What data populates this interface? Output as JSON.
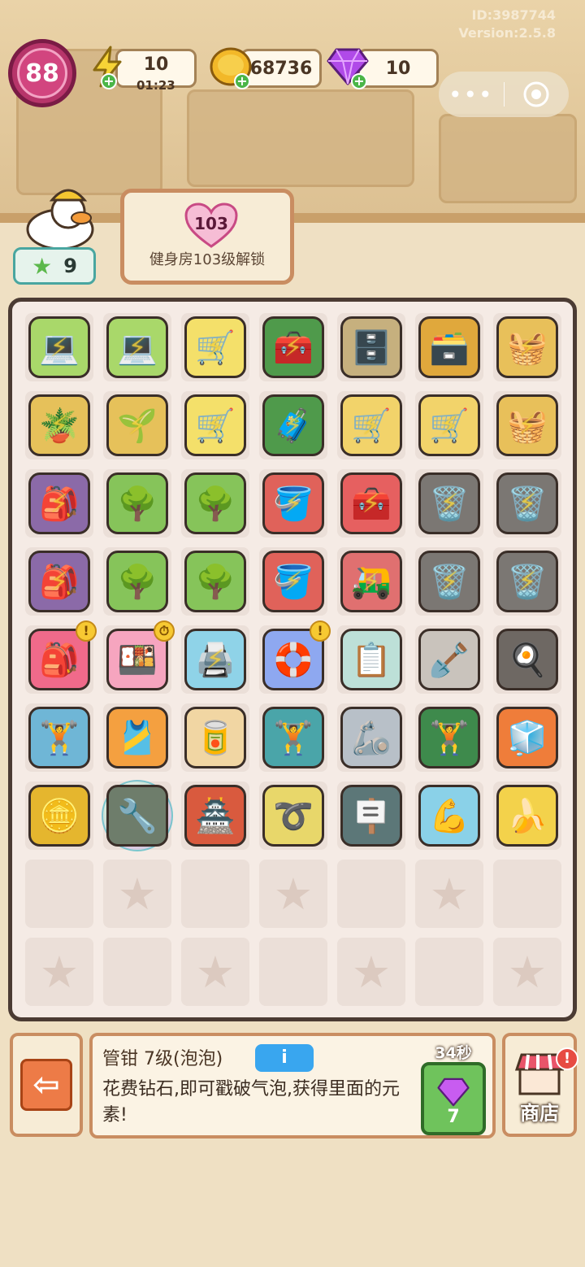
{
  "meta": {
    "id_text": "ID:3987744",
    "version_text": "Version:2.5.8"
  },
  "hud": {
    "level": "88",
    "energy": {
      "value": "10",
      "timer": "01:23",
      "icon": "lightning-icon"
    },
    "coins": {
      "value": "68736",
      "icon": "coin-icon"
    },
    "gems": {
      "value": "10",
      "icon": "gem-icon"
    }
  },
  "capsule": {
    "more_icon": "more-dots-icon",
    "close_icon": "target-icon"
  },
  "player": {
    "stars": "9"
  },
  "unlock": {
    "level": "103",
    "text": "健身房103级解锁"
  },
  "board": {
    "rows": [
      [
        {
          "icon": "💻",
          "color": "#a9d86a",
          "bolt": true
        },
        {
          "icon": "💻",
          "color": "#a9d86a",
          "bolt": true
        },
        {
          "icon": "🛒",
          "color": "#f4e06a",
          "bolt": true
        },
        {
          "icon": "🧰",
          "color": "#4f9a4b",
          "bolt": true
        },
        {
          "icon": "🗄️",
          "color": "#c6b07e",
          "bolt": false
        },
        {
          "icon": "🗃️",
          "color": "#e0a83c",
          "bolt": false
        },
        {
          "icon": "🧺",
          "color": "#e8c05a",
          "bolt": true
        }
      ],
      [
        {
          "icon": "🪴",
          "color": "#e6c15a",
          "bolt": true
        },
        {
          "icon": "🌱",
          "color": "#e6c15a",
          "bolt": true
        },
        {
          "icon": "🛒",
          "color": "#f4e06a",
          "bolt": true
        },
        {
          "icon": "🧳",
          "color": "#4f9a4b",
          "bolt": true
        },
        {
          "icon": "🛒",
          "color": "#f2d36a",
          "bolt": true
        },
        {
          "icon": "🛒",
          "color": "#f2d36a",
          "bolt": true
        },
        {
          "icon": "🧺",
          "color": "#e8c05a",
          "bolt": true
        }
      ],
      [
        {
          "icon": "🎒",
          "color": "#8b6aa8",
          "bolt": true
        },
        {
          "icon": "🌳",
          "color": "#86c45a",
          "bolt": false
        },
        {
          "icon": "🌳",
          "color": "#86c45a",
          "bolt": false
        },
        {
          "icon": "🪣",
          "color": "#e0625a",
          "bolt": true
        },
        {
          "icon": "🧰",
          "color": "#e66060",
          "bolt": true
        },
        {
          "icon": "🗑️",
          "color": "#7b7773",
          "bolt": true
        },
        {
          "icon": "🗑️",
          "color": "#7b7773",
          "bolt": true
        }
      ],
      [
        {
          "icon": "🎒",
          "color": "#8b6aa8",
          "bolt": true
        },
        {
          "icon": "🌳",
          "color": "#86c45a",
          "bolt": false
        },
        {
          "icon": "🌳",
          "color": "#86c45a",
          "bolt": false
        },
        {
          "icon": "🪣",
          "color": "#e0625a",
          "bolt": true
        },
        {
          "icon": "🛺",
          "color": "#e07070",
          "bolt": true
        },
        {
          "icon": "🗑️",
          "color": "#7b7773",
          "bolt": true
        },
        {
          "icon": "🗑️",
          "color": "#7b7773",
          "bolt": true
        }
      ],
      [
        {
          "icon": "🎒",
          "color": "#f06a8a",
          "bolt": false,
          "badge": "!"
        },
        {
          "icon": "🍱",
          "color": "#f6a5bf",
          "bolt": false,
          "badge": "⏱"
        },
        {
          "icon": "🖨️",
          "color": "#8fd3e8",
          "bolt": true
        },
        {
          "icon": "🛟",
          "color": "#8ea8f0",
          "bolt": false,
          "badge": "!"
        },
        {
          "icon": "📋",
          "color": "#bde0d8",
          "bolt": false
        },
        {
          "icon": "🪏",
          "color": "#c9c3bc",
          "bolt": false
        },
        {
          "icon": "🍳",
          "color": "#6e6863",
          "bolt": false
        }
      ],
      [
        {
          "icon": "🏋️",
          "color": "#6fb6d6",
          "bolt": false
        },
        {
          "icon": "🎽",
          "color": "#f4a040",
          "bolt": false
        },
        {
          "icon": "🥫",
          "color": "#f1d6a3",
          "bolt": false
        },
        {
          "icon": "🏋️",
          "color": "#4aa5a9",
          "bolt": false
        },
        {
          "icon": "🦾",
          "color": "#b8c0c8",
          "bolt": false
        },
        {
          "icon": "🏋️",
          "color": "#3e8a4c",
          "bolt": false
        },
        {
          "icon": "🧊",
          "color": "#ef7d3a",
          "bolt": false
        }
      ],
      [
        {
          "icon": "🪙",
          "color": "#e5b62e",
          "bolt": false
        },
        {
          "icon": "🔧",
          "color": "#6e7d6b",
          "bolt": false,
          "bubble": true
        },
        {
          "icon": "🏯",
          "color": "#d95a3e",
          "bolt": false
        },
        {
          "icon": "➰",
          "color": "#e8d76a",
          "bolt": false
        },
        {
          "icon": "🪧",
          "color": "#5c7778",
          "bolt": false
        },
        {
          "icon": "💪",
          "color": "#8ad1e8",
          "bolt": false
        },
        {
          "icon": "🍌",
          "color": "#f3d24b",
          "bolt": false
        }
      ],
      [
        {
          "empty": true,
          "star": false
        },
        {
          "empty": true,
          "star": true
        },
        {
          "empty": true,
          "star": false
        },
        {
          "empty": true,
          "star": true
        },
        {
          "empty": true,
          "star": false
        },
        {
          "empty": true,
          "star": true
        },
        {
          "empty": true,
          "star": false
        }
      ],
      [
        {
          "empty": true,
          "star": true
        },
        {
          "empty": true,
          "star": false
        },
        {
          "empty": true,
          "star": true
        },
        {
          "empty": true,
          "star": false
        },
        {
          "empty": true,
          "star": true
        },
        {
          "empty": true,
          "star": false
        },
        {
          "empty": true,
          "star": true
        }
      ]
    ]
  },
  "bottom": {
    "item_title": "管钳 7级(泡泡)",
    "info_label": "i",
    "description": "花费钻石,即可戳破气泡,获得里面的元素!",
    "pop_timer": "34秒",
    "pop_cost": "7",
    "shop_label": "商店",
    "shop_alert": "!"
  }
}
